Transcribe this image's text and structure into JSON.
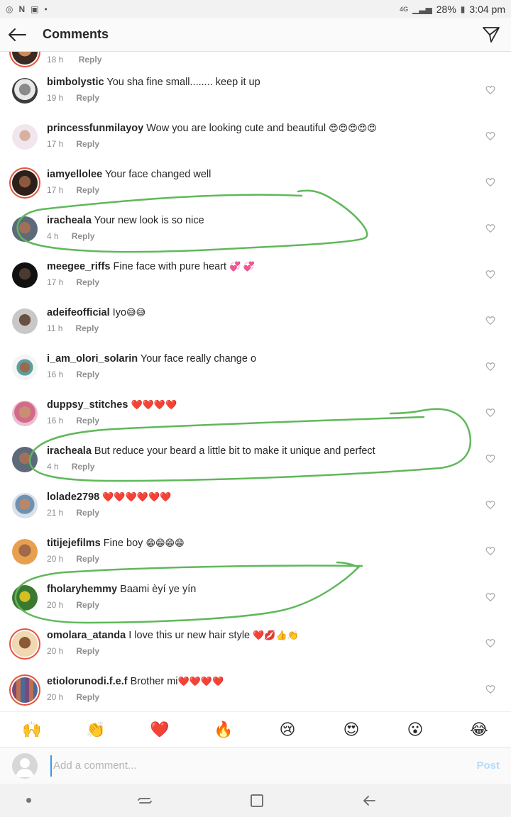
{
  "status_bar": {
    "network": "4G",
    "battery": "28%",
    "time": "3:04 pm"
  },
  "header": {
    "title": "Comments"
  },
  "partial_comment": {
    "time": "18 h",
    "reply": "Reply"
  },
  "comments": [
    {
      "user": "bimbolystic",
      "text": "You sha fine small........ keep it up",
      "emoji": "",
      "time": "19 h",
      "reply": "Reply"
    },
    {
      "user": "princessfunmilayoy",
      "text": "Wow you are looking cute and beautiful",
      "emoji": "😍😍😍😍😍",
      "time": "17 h",
      "reply": "Reply"
    },
    {
      "user": "iamyellolee",
      "text": "Your face changed well",
      "emoji": "",
      "time": "17 h",
      "reply": "Reply"
    },
    {
      "user": "iracheala",
      "text": "Your new look is so nice",
      "emoji": "",
      "time": "4 h",
      "reply": "Reply"
    },
    {
      "user": "meegee_riffs",
      "text": "Fine face with pure heart",
      "emoji": "💞 💞",
      "time": "17 h",
      "reply": "Reply"
    },
    {
      "user": "adeifeofficial",
      "text": "Iyo",
      "emoji": "😅😅",
      "time": "11 h",
      "reply": "Reply"
    },
    {
      "user": "i_am_olori_solarin",
      "text": "Your face really change o",
      "emoji": "",
      "time": "16 h",
      "reply": "Reply"
    },
    {
      "user": "duppsy_stitches",
      "text": "",
      "emoji": "❤️❤️❤️❤️",
      "time": "16 h",
      "reply": "Reply"
    },
    {
      "user": "iracheala",
      "text": "But reduce your beard a little bit to make it unique and perfect",
      "emoji": "",
      "time": "4 h",
      "reply": "Reply"
    },
    {
      "user": "lolade2798",
      "text": "",
      "emoji": "❤️❤️❤️❤️❤️❤️",
      "time": "21 h",
      "reply": "Reply"
    },
    {
      "user": "titijejefilms",
      "text": "Fine boy",
      "emoji": "😁😁😁😁",
      "time": "20 h",
      "reply": "Reply"
    },
    {
      "user": "fholaryhemmy",
      "text": "Baami èyí ye yín",
      "emoji": "",
      "time": "20 h",
      "reply": "Reply"
    },
    {
      "user": "omolara_atanda",
      "text": "I love this ur new hair style",
      "emoji": "❤️💋👍👏",
      "time": "20 h",
      "reply": "Reply"
    },
    {
      "user": "etiolorunodi.f.e.f",
      "text": "Brother mi",
      "emoji": "❤️❤️❤️❤️",
      "time": "20 h",
      "reply": "Reply"
    }
  ],
  "emoji_bar": [
    "🙌",
    "👏",
    "❤️",
    "🔥",
    "😢",
    "😍",
    "😮",
    "😂"
  ],
  "composer": {
    "placeholder": "Add a comment...",
    "post_label": "Post"
  },
  "colors": {
    "annotation": "#5fb85a",
    "story_ring": "#e2553f",
    "post_disabled": "#b3dbff"
  }
}
